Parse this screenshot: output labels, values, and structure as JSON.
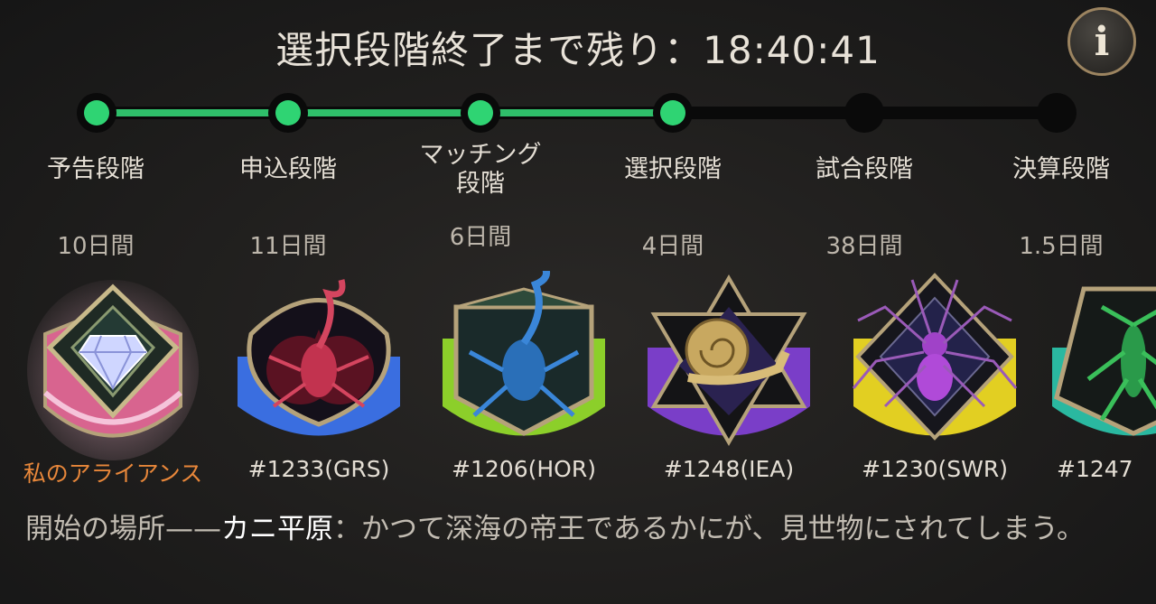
{
  "header": {
    "countdown_label": "選択段階終了まで残り：18:40:41"
  },
  "info_button": {
    "glyph": "i"
  },
  "phases": [
    {
      "label": "予告段階",
      "duration": "10日間",
      "completed": true
    },
    {
      "label": "申込段階",
      "duration": "11日間",
      "completed": true
    },
    {
      "label": "マッチング\n段階",
      "duration": "6日間",
      "completed": true
    },
    {
      "label": "選択段階",
      "duration": "4日間",
      "completed": true
    },
    {
      "label": "試合段階",
      "duration": "38日間",
      "completed": false
    },
    {
      "label": "決算段階",
      "duration": "1.5日間",
      "completed": false
    }
  ],
  "alliances": [
    {
      "name": "私のアライアンス",
      "icon": "diamond-icon",
      "color": "#e87aa8",
      "mine": true
    },
    {
      "name": "#1233(GRS)",
      "icon": "scorpion-icon",
      "color": "#3a6ee0",
      "mine": false
    },
    {
      "name": "#1206(HOR)",
      "icon": "scorpion-icon",
      "color": "#8ccf2a",
      "mine": false
    },
    {
      "name": "#1248(IEA)",
      "icon": "snail-icon",
      "color": "#7a3ec8",
      "mine": false
    },
    {
      "name": "#1230(SWR)",
      "icon": "spider-icon",
      "color": "#e2cf22",
      "mine": false
    },
    {
      "name": "#1247",
      "icon": "mantis-icon",
      "color": "#2ab8a0",
      "mine": false
    }
  ],
  "description": {
    "prefix": "開始の場所——",
    "location": "カニ平原",
    "suffix": "：かつて深海の帝王であるかにが、見世物にされてしまう。"
  }
}
